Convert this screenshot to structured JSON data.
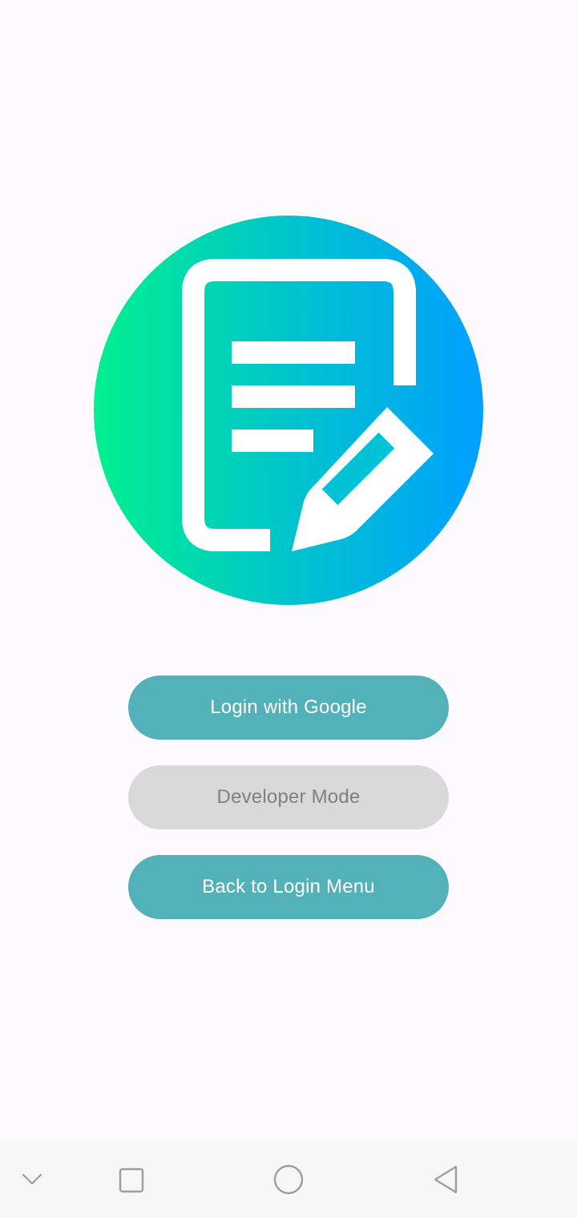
{
  "app": {
    "logo_icon": "document-edit-icon",
    "gradient": {
      "start": "#00f08f",
      "mid": "#00c4cc",
      "end": "#00a0ff"
    }
  },
  "buttons": {
    "google_login_label": "Login with Google",
    "developer_mode_label": "Developer Mode",
    "back_to_login_label": "Back to Login Menu"
  },
  "colors": {
    "primary_button": "#52b1b9",
    "disabled_button": "#d9d9d9",
    "disabled_text": "#808080",
    "background": "#fdfafd"
  },
  "navigation_bar": {
    "icons": [
      "chevron-down-icon",
      "recents-square-icon",
      "home-circle-icon",
      "back-triangle-icon"
    ]
  }
}
